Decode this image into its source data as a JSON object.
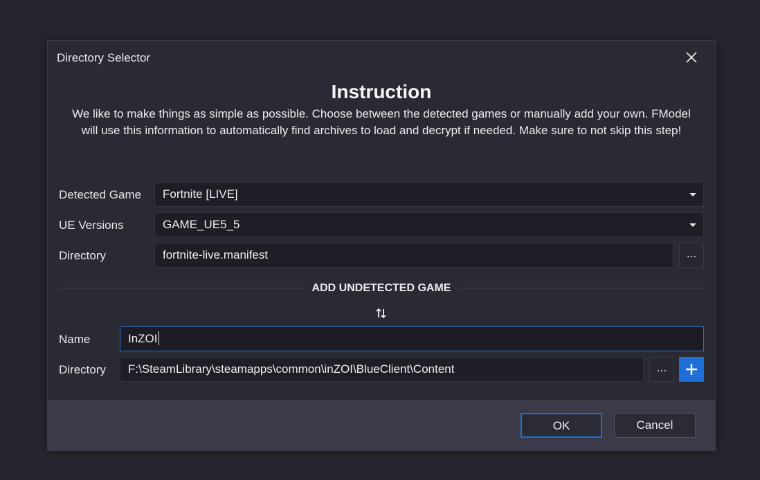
{
  "window": {
    "title": "Directory Selector",
    "close_icon": "close-icon"
  },
  "instruction": {
    "title": "Instruction",
    "body": "We like to make things as simple as possible. Choose between the detected games or manually add your own. FModel will use this information to automatically find archives to load and decrypt if needed. Make sure to not skip this step!"
  },
  "detected": {
    "game_label": "Detected Game",
    "game_value": "Fortnite [LIVE]",
    "ue_label": "UE Versions",
    "ue_value": "GAME_UE5_5",
    "dir_label": "Directory",
    "dir_value": "fortnite-live.manifest",
    "browse_label": "..."
  },
  "undetected": {
    "section_title": "ADD UNDETECTED GAME",
    "name_label": "Name",
    "name_value": "InZOI",
    "dir_label": "Directory",
    "dir_value": "F:\\SteamLibrary\\steamapps\\common\\inZOI\\BlueClient\\Content",
    "browse_label": "...",
    "add_icon": "plus-icon",
    "swap_icon": "swap-arrows-icon"
  },
  "footer": {
    "ok_label": "OK",
    "cancel_label": "Cancel"
  },
  "colors": {
    "accent": "#1f6fd8",
    "background": "#262630",
    "dialog": "#2a2a35",
    "footer": "#3a3a48"
  }
}
